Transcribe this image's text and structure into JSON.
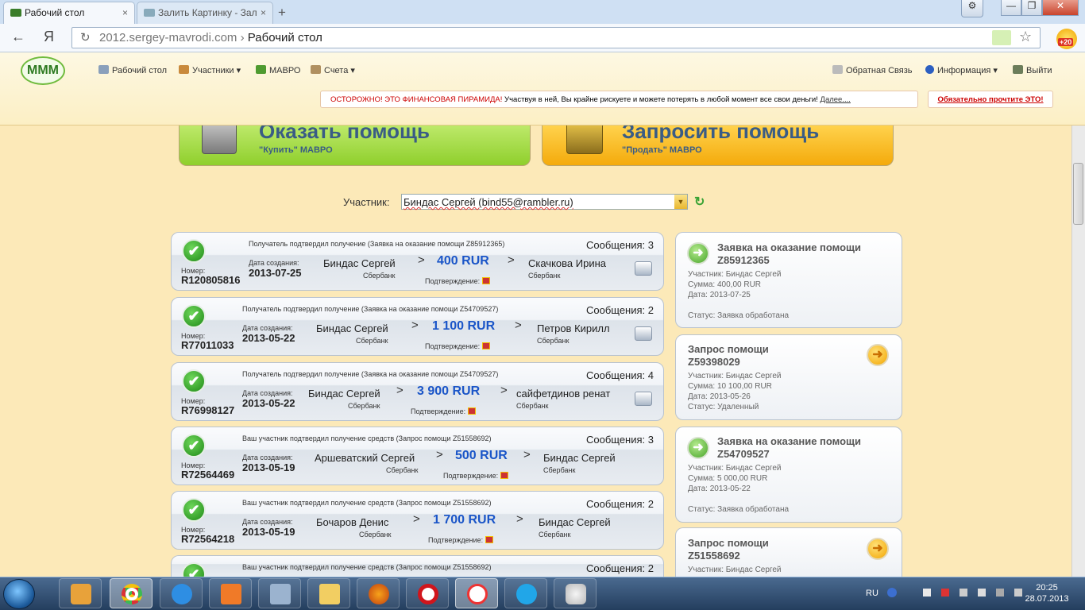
{
  "browser": {
    "tabs": [
      {
        "label": "Рабочий стол",
        "active": true
      },
      {
        "label": "Залить Картинку - Зал",
        "active": false
      }
    ],
    "new_tab": "+",
    "close": "×",
    "window_controls": {
      "minimize": "—",
      "maximize": "❐",
      "close": "✕"
    },
    "back": "←",
    "logo": "Я",
    "reload": "↻",
    "url_host": "2012.sergey-mavrodi.com",
    "url_separator": " › ",
    "url_page": "Рабочий стол",
    "star": "☆",
    "badge": "+20"
  },
  "header": {
    "logo": "МММ",
    "nav": [
      {
        "label": "Рабочий стол",
        "icon": "desktop-icon"
      },
      {
        "label": "Участники ▾",
        "icon": "users-icon"
      },
      {
        "label": "МАВРО",
        "icon": "mavro-icon"
      },
      {
        "label": "Счета ▾",
        "icon": "accounts-icon"
      }
    ],
    "nav_right": [
      {
        "label": "Обратная Связь",
        "icon": "feedback-icon"
      },
      {
        "label": "Информация ▾",
        "icon": "info-icon"
      },
      {
        "label": "Выйти",
        "icon": "exit-icon"
      }
    ],
    "warning_red": "ОСТОРОЖНО! ЭТО ФИНАНСОВАЯ ПИРАМИДА!",
    "warning_text": " Участвуя в ней, Вы крайне рискуете и можете потерять в любой момент все свои деньги! ",
    "warning_link": "Далее....",
    "readme": "Обязательно прочтите ЭТО!"
  },
  "banners": {
    "give": {
      "title": "Оказать помощь",
      "subtitle": "\"Купить\" МАВРО",
      "color": "#9fd640"
    },
    "request": {
      "title": "Запросить помощь",
      "subtitle": "\"Продать\" МАВРО",
      "color": "#f7b313"
    }
  },
  "participant": {
    "label": "Участник:",
    "value": "Биндас Сергей (bind55@rambler.ru)",
    "arrow": "▼",
    "refresh": "↻"
  },
  "labels": {
    "number": "Номер:",
    "created": "Дата создания:",
    "confirmation": "Подтверждение:",
    "arrow": ">",
    "check": "✔"
  },
  "transactions": [
    {
      "status": "Получатель подтвердил получение (Заявка на оказание помощи Z85912365)",
      "messages": "Сообщения: 3",
      "number": "R120805816",
      "date": "2013-07-25",
      "from": "Биндас Сергей",
      "from_bank": "Сбербанк",
      "amount": "400 RUR",
      "to": "Скачкова Ирина",
      "to_bank": "Сбербанк"
    },
    {
      "status": "Получатель подтвердил получение (Заявка на оказание помощи Z54709527)",
      "messages": "Сообщения: 2",
      "number": "R77011033",
      "date": "2013-05-22",
      "from": "Биндас Сергей",
      "from_bank": "Сбербанк",
      "amount": "1 100 RUR",
      "to": "Петров Кирилл",
      "to_bank": "Сбербанк"
    },
    {
      "status": "Получатель подтвердил получение (Заявка на оказание помощи Z54709527)",
      "messages": "Сообщения: 4",
      "number": "R76998127",
      "date": "2013-05-22",
      "from": "Биндас Сергей",
      "from_bank": "Сбербанк",
      "amount": "3 900 RUR",
      "to": "сайфетдинов ренат",
      "to_bank": "Сбербанк"
    },
    {
      "status": "Ваш участник подтвердил получение средств (Запрос помощи Z51558692)",
      "messages": "Сообщения: 3",
      "number": "R72564469",
      "date": "2013-05-19",
      "from": "Аршеватский Сергей",
      "from_bank": "Сбербанк",
      "amount": "500 RUR",
      "to": "Биндас Сергей",
      "to_bank": "Сбербанк"
    },
    {
      "status": "Ваш участник подтвердил получение средств (Запрос помощи Z51558692)",
      "messages": "Сообщения: 2",
      "number": "R72564218",
      "date": "2013-05-19",
      "from": "Бочаров Денис",
      "from_bank": "Сбербанк",
      "amount": "1 700 RUR",
      "to": "Биндас Сергей",
      "to_bank": "Сбербанк"
    },
    {
      "status": "Ваш участник подтвердил получение средств (Запрос помощи Z51558692)",
      "messages": "Сообщения: 2"
    }
  ],
  "requests": [
    {
      "type": "give",
      "title": "Заявка на оказание помощи",
      "id": "Z85912365",
      "participant": "Участник: Биндас Сергей",
      "sum": "Сумма: 400,00 RUR",
      "date": "Дата: 2013-07-25",
      "status": "Статус: Заявка обработана"
    },
    {
      "type": "request",
      "title": "Запрос помощи",
      "id": "Z59398029",
      "participant": "Участник: Биндас Сергей",
      "sum": "Сумма: 10 100,00 RUR",
      "date": "Дата: 2013-05-26",
      "status": "Статус: Удаленный"
    },
    {
      "type": "give",
      "title": "Заявка на оказание помощи",
      "id": "Z54709527",
      "participant": "Участник: Биндас Сергей",
      "sum": "Сумма: 5 000,00 RUR",
      "date": "Дата: 2013-05-22",
      "status": "Статус: Заявка обработана"
    },
    {
      "type": "request",
      "title": "Запрос помощи",
      "id": "Z51558692",
      "participant": "Участник: Биндас Сергей"
    }
  ],
  "request_icons": {
    "give": "➜",
    "request": "➜"
  },
  "taskbar": {
    "apps": [
      "media-player",
      "chrome",
      "internet-explorer",
      "office",
      "scanner",
      "folder",
      "firefox",
      "opera",
      "yandex-browser",
      "skype",
      "paint"
    ],
    "lang": "RU",
    "time": "20:25",
    "date": "28.07.2013"
  }
}
